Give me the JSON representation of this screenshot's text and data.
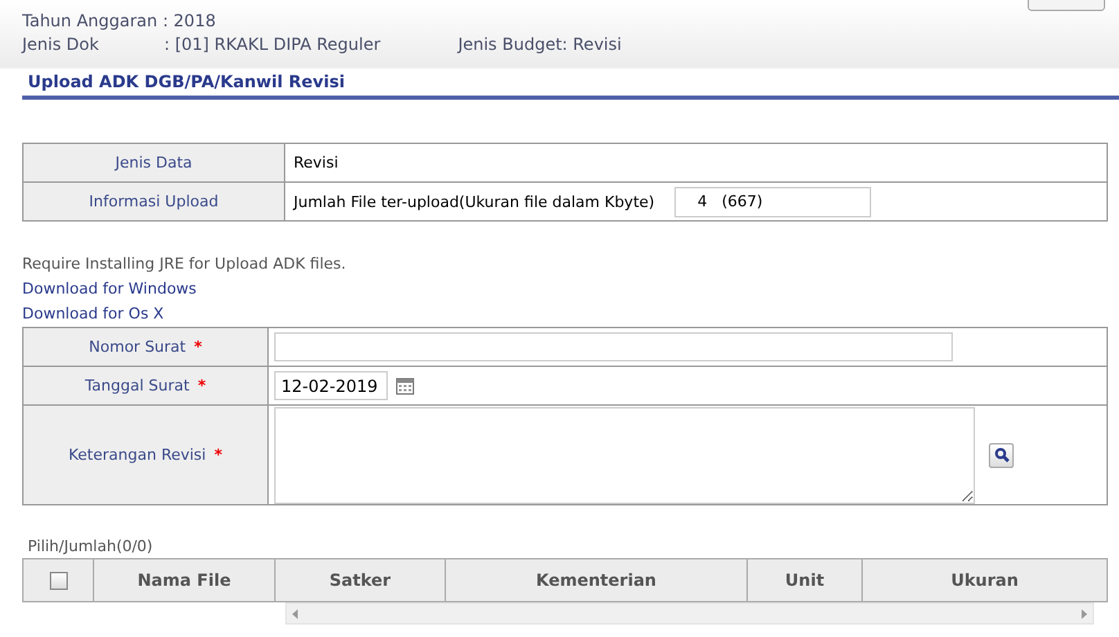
{
  "header": {
    "lines": [
      [
        {
          "text": "Tahun Anggaran : 2018"
        }
      ],
      [
        {
          "text": "Jenis Dok"
        },
        {
          "text": ": [01] RKAKL DIPA Reguler"
        },
        {
          "text": "Jenis Budget: Revisi"
        }
      ]
    ]
  },
  "page_title": "Upload ADK DGB/PA/Kanwil Revisi",
  "info_table": [
    {
      "label": "Jenis Data",
      "value": "Revisi"
    },
    {
      "label": "Informasi Upload",
      "value": "Jumlah File ter-upload(Ukuran file dalam Kbyte)",
      "box": "4   (667)"
    }
  ],
  "note": "Require Installing JRE for Upload ADK files.",
  "links": [
    "Download for Windows",
    "Download for Os X"
  ],
  "form": [
    {
      "kind": "text",
      "label": "Nomor Surat",
      "marker": "*"
    },
    {
      "kind": "date",
      "label": "Tanggal Surat",
      "marker": "*",
      "value": "12-02-2019"
    },
    {
      "kind": "textarea",
      "label": "Keterangan Revisi",
      "marker": "*"
    }
  ],
  "grid": {
    "count": "Pilih/Jumlah(0/0)",
    "select_all": {
      "checked": false
    },
    "columns": [
      "Nama File",
      "Satker",
      "Kementerian",
      "Unit",
      "Ukuran"
    ]
  }
}
